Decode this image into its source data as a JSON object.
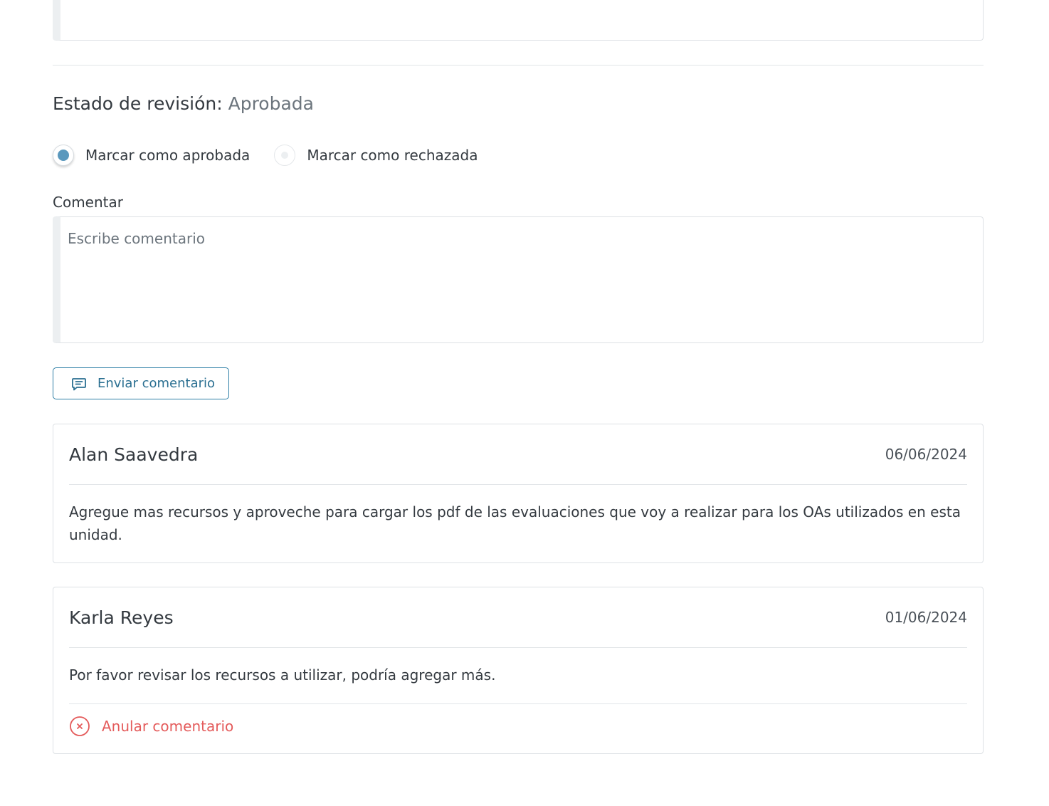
{
  "top_field": {
    "partial_text": "─ ─ ─ ─ ─ ─ ─ ─ ─ ─ ─ ─ ─ ─ , ─ ─ ─ ─ ─"
  },
  "review": {
    "status_label": "Estado de revisión:",
    "status_value": "Aprobada",
    "options": [
      {
        "label": "Marcar como aprobada",
        "selected": true
      },
      {
        "label": "Marcar como rechazada",
        "selected": false
      }
    ]
  },
  "comment_form": {
    "label": "Comentar",
    "placeholder": "Escribe comentario",
    "send_button_label": "Enviar comentario",
    "send_icon": "message-square-text-icon"
  },
  "comments": [
    {
      "author": "Alan Saavedra",
      "date": "06/06/2024",
      "text": "Agregue mas recursos y aproveche para cargar los pdf de las evaluaciones que voy a realizar para los OAs utilizados en esta unidad."
    },
    {
      "author": "Karla Reyes",
      "date": "01/06/2024",
      "text": "Por favor revisar los recursos a utilizar, podría agregar más.",
      "cancel_label": "Anular comentario",
      "cancel_icon": "x-circle-icon"
    }
  ],
  "colors": {
    "accent": "#2e7fa6",
    "radio_selected": "#5a98bd",
    "danger": "#e45b5b",
    "muted_text": "#6c757d",
    "border": "#dde1e5"
  }
}
